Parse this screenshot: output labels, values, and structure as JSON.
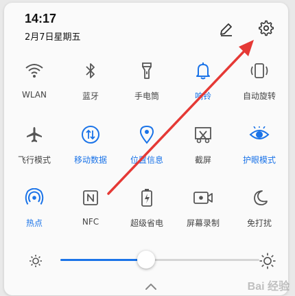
{
  "status": {
    "time": "14:17",
    "date": "2月7日星期五"
  },
  "header_icons": {
    "edit": "pencil-icon",
    "settings": "gear-icon"
  },
  "tiles": [
    {
      "label": "WLAN",
      "icon": "wifi-icon",
      "active": false
    },
    {
      "label": "蓝牙",
      "icon": "bluetooth-icon",
      "active": false
    },
    {
      "label": "手电筒",
      "icon": "flashlight-icon",
      "active": false
    },
    {
      "label": "响铃",
      "icon": "bell-icon",
      "active": true
    },
    {
      "label": "自动旋转",
      "icon": "rotate-icon",
      "active": false
    },
    {
      "label": "飞行模式",
      "icon": "airplane-icon",
      "active": false
    },
    {
      "label": "移动数据",
      "icon": "mobile-data-icon",
      "active": true
    },
    {
      "label": "位置信息",
      "icon": "location-icon",
      "active": true
    },
    {
      "label": "截屏",
      "icon": "screenshot-icon",
      "active": false
    },
    {
      "label": "护眼模式",
      "icon": "eye-icon",
      "active": true
    },
    {
      "label": "热点",
      "icon": "hotspot-icon",
      "active": true
    },
    {
      "label": "NFC",
      "icon": "nfc-icon",
      "active": false
    },
    {
      "label": "超级省电",
      "icon": "battery-saver-icon",
      "active": false
    },
    {
      "label": "屏幕录制",
      "icon": "screen-record-icon",
      "active": false
    },
    {
      "label": "免打扰",
      "icon": "moon-icon",
      "active": false
    }
  ],
  "brightness": {
    "level": 0.43
  },
  "colors": {
    "accent": "#1a73e8",
    "icon_inactive": "#555555",
    "annotation_arrow": "#e53935"
  },
  "watermark": "Bai 经验"
}
